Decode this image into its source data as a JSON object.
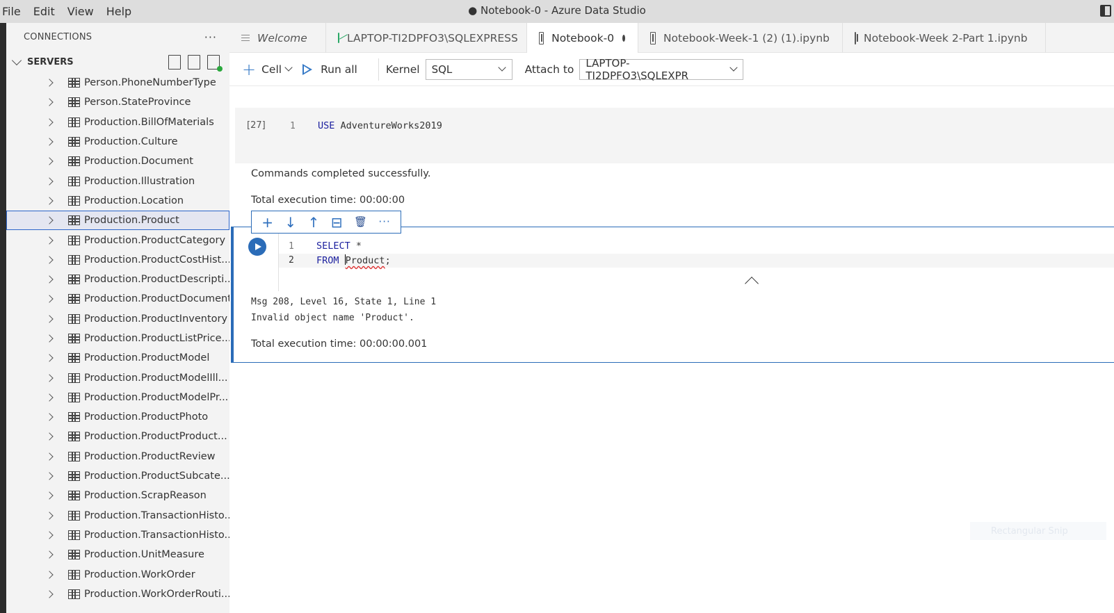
{
  "menu": [
    "File",
    "Edit",
    "View",
    "Help"
  ],
  "window_title": "● Notebook-0 - Azure Data Studio",
  "sidebar": {
    "header": "CONNECTIONS",
    "more": "···",
    "servers_label": "SERVERS",
    "items": [
      "Person.PhoneNumberType",
      "Person.StateProvince",
      "Production.BillOfMaterials",
      "Production.Culture",
      "Production.Document",
      "Production.Illustration",
      "Production.Location",
      "Production.Product",
      "Production.ProductCategory",
      "Production.ProductCostHist...",
      "Production.ProductDescripti...",
      "Production.ProductDocument",
      "Production.ProductInventory",
      "Production.ProductListPrice...",
      "Production.ProductModel",
      "Production.ProductModelIll...",
      "Production.ProductModelPr...",
      "Production.ProductPhoto",
      "Production.ProductProduct...",
      "Production.ProductReview",
      "Production.ProductSubcate...",
      "Production.ScrapReason",
      "Production.TransactionHisto...",
      "Production.TransactionHisto...",
      "Production.UnitMeasure",
      "Production.WorkOrder",
      "Production.WorkOrderRouti..."
    ],
    "selected_index": 7
  },
  "tabs": [
    {
      "label": "Welcome",
      "icon": "welcome-icon"
    },
    {
      "label": "LAPTOP-TI2DPFO3\\SQLEXPRESS",
      "icon": "dashboard-icon"
    },
    {
      "label": "Notebook-0",
      "icon": "notebook-icon"
    },
    {
      "label": "Notebook-Week-1 (2) (1).ipynb",
      "icon": "notebook-icon"
    },
    {
      "label": "Notebook-Week 2-Part 1.ipynb",
      "icon": "notebook-icon"
    }
  ],
  "toolbar": {
    "cell_label": "Cell",
    "run_all_label": "Run all",
    "kernel_label": "Kernel",
    "kernel_value": "SQL",
    "attach_label": "Attach to",
    "attach_value": "LAPTOP-TI2DPFO3\\SQLEXPR"
  },
  "cell1": {
    "exec_count": "[27]",
    "line_no": "1",
    "keyword": "USE",
    "code_rest": " AdventureWorks2019",
    "output1": "Commands completed successfully.",
    "output2": "Total execution time: 00:00:00"
  },
  "cell_toolbar": [
    "+",
    "↓",
    "↑",
    "⊟",
    "🗑",
    "···"
  ],
  "cell2": {
    "line1_no": "1",
    "line1_kw": "SELECT",
    "line1_rest": " *",
    "line2_no": "2",
    "line2_kw": "FROM",
    "line2_space": " ",
    "line2_ident": "Product",
    "line2_end": ";",
    "error1": "Msg 208, Level 16, State 1, Line 1",
    "error2": "Invalid object name 'Product'.",
    "exec_time": "Total execution time: 00:00:00.001"
  },
  "ghost_text": "Rectangular Snip"
}
